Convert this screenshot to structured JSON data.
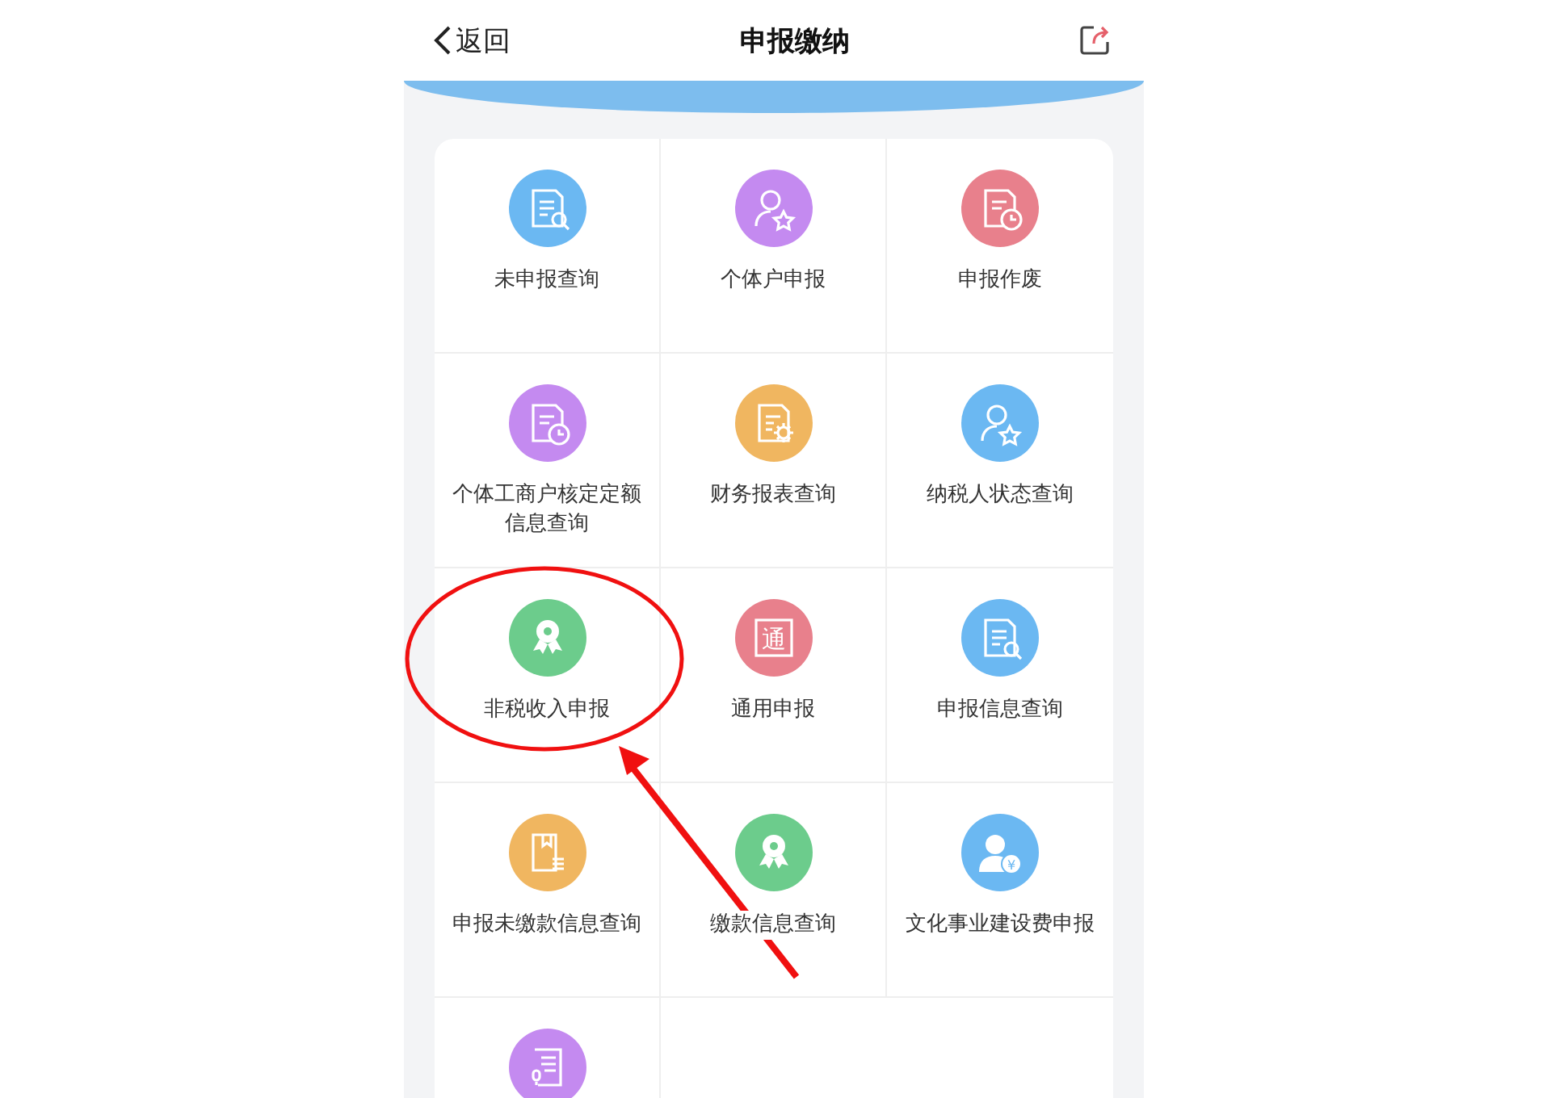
{
  "header": {
    "back": "返回",
    "title": "申报缴纳"
  },
  "services": [
    {
      "label": "未申报查询",
      "kind": "doc-search",
      "color": "#6bb8f2"
    },
    {
      "label": "个体户申报",
      "kind": "user-star",
      "color": "#c48af0"
    },
    {
      "label": "申报作废",
      "kind": "doc-clock",
      "color": "#e8808c"
    },
    {
      "label": "个体工商户核定定额信息查询",
      "kind": "doc-clock",
      "color": "#c48af0"
    },
    {
      "label": "财务报表查询",
      "kind": "doc-gear",
      "color": "#f0b660"
    },
    {
      "label": "纳税人状态查询",
      "kind": "user-star",
      "color": "#6bb8f2"
    },
    {
      "label": "非税收入申报",
      "kind": "award",
      "color": "#6ccc8c"
    },
    {
      "label": "通用申报",
      "kind": "glyph",
      "icon_text": "通",
      "color": "#e8808c"
    },
    {
      "label": "申报信息查询",
      "kind": "doc-search",
      "color": "#6bb8f2"
    },
    {
      "label": "申报未缴款信息查询",
      "kind": "bookmark",
      "color": "#f0b660"
    },
    {
      "label": "缴款信息查询",
      "kind": "award",
      "color": "#6ccc8c"
    },
    {
      "label": "文化事业建设费申报",
      "kind": "coin",
      "icon_text": "¥",
      "color": "#6bb8f2"
    },
    {
      "kind": "scroll",
      "color": "#c48af0"
    }
  ]
}
